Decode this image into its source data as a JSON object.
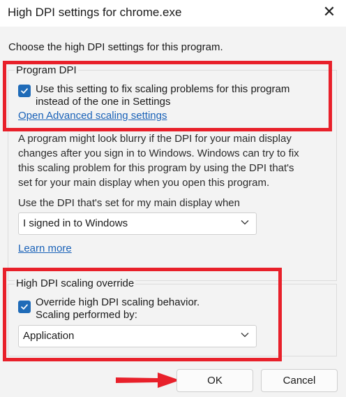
{
  "window": {
    "title": "High DPI settings for chrome.exe",
    "close_glyph": "✕"
  },
  "intro": "Choose the high DPI settings for this program.",
  "program_dpi": {
    "group_label": "Program DPI",
    "checkbox_checked": true,
    "checkbox_line1": "Use this setting to fix scaling problems for this program",
    "checkbox_line2": "instead of the one in Settings",
    "advanced_link": "Open Advanced scaling settings",
    "description_lines": [
      "A program might look blurry if the DPI for your main display",
      "changes after you sign in to Windows. Windows can try to fix",
      "this scaling problem for this program by using the DPI that's",
      "set for your main display when you open this program."
    ],
    "dpi_when_label": "Use the DPI that's set for my main display when",
    "dpi_when_value": "I signed in to Windows",
    "learn_more": "Learn more"
  },
  "override": {
    "group_label": "High DPI scaling override",
    "checkbox_checked": true,
    "checkbox_line1": "Override high DPI scaling behavior.",
    "checkbox_line2": "Scaling performed by:",
    "scaling_value": "Application"
  },
  "buttons": {
    "ok": "OK",
    "cancel": "Cancel"
  },
  "colors": {
    "accent": "#1f6bb8",
    "link": "#1a62b8",
    "highlight": "#e8202a"
  },
  "icons": [
    "close-icon",
    "checkmark-icon",
    "chevron-down-icon",
    "arrow-right-icon"
  ]
}
